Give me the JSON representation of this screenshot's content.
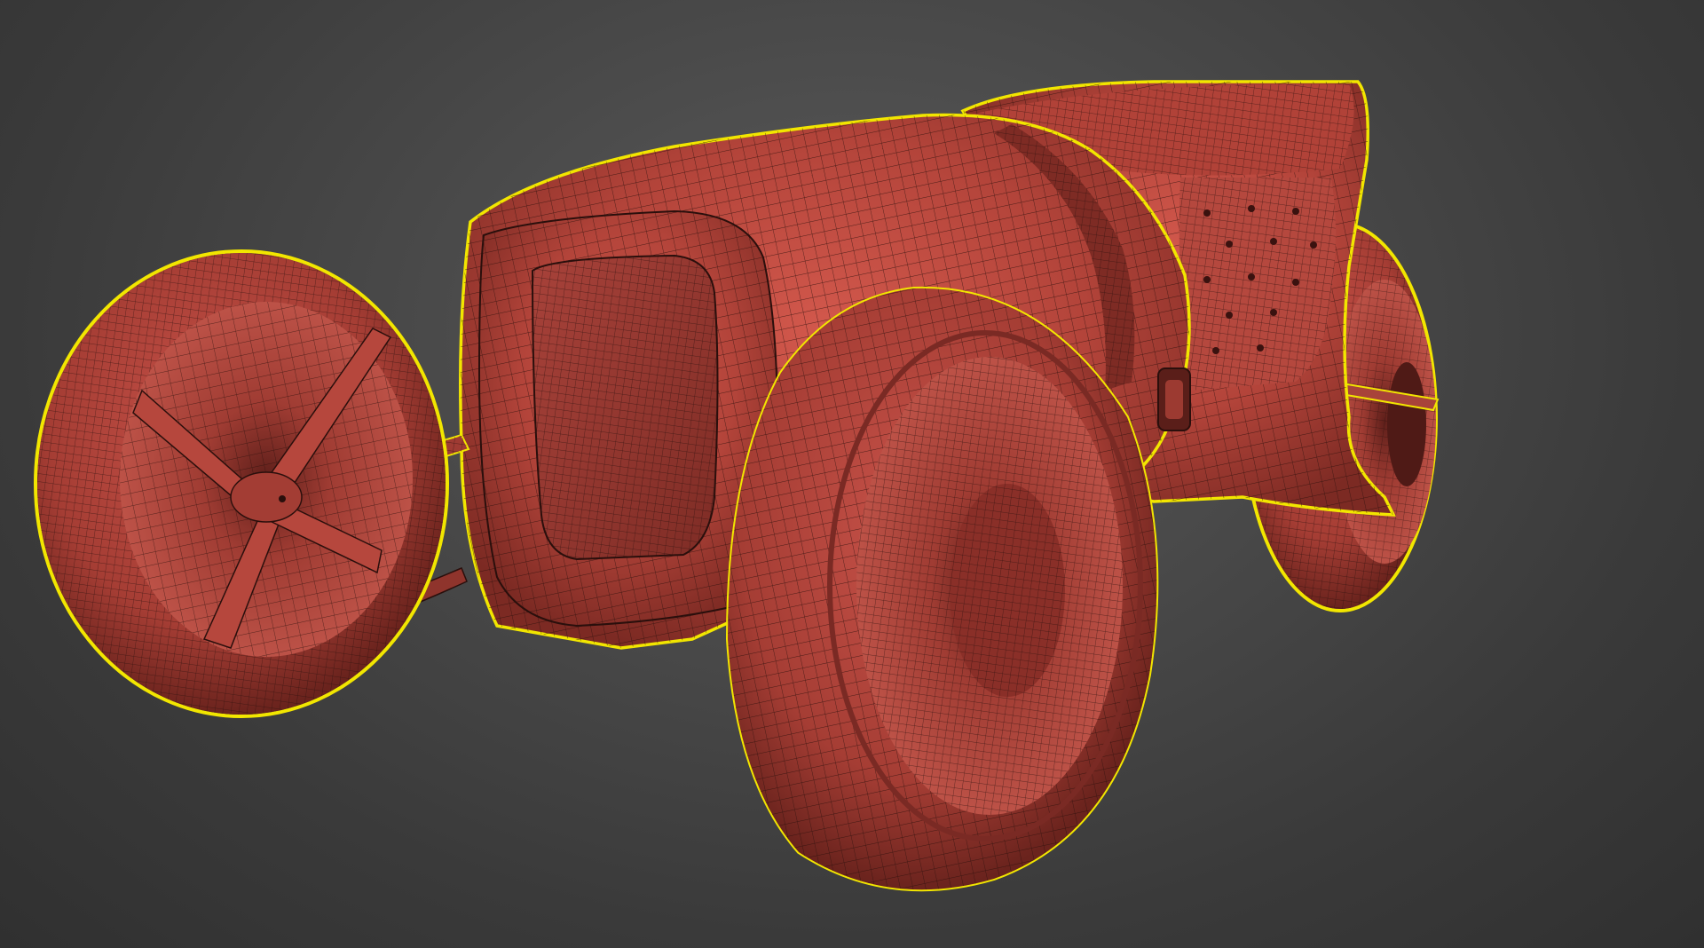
{
  "viewport": {
    "background_color": "#444444",
    "object_color": "#b9453b",
    "wireframe_color": "#2a0f0c",
    "selection_outline_color": "#f2e600"
  },
  "object": {
    "selected": true,
    "wire_density": "high"
  }
}
